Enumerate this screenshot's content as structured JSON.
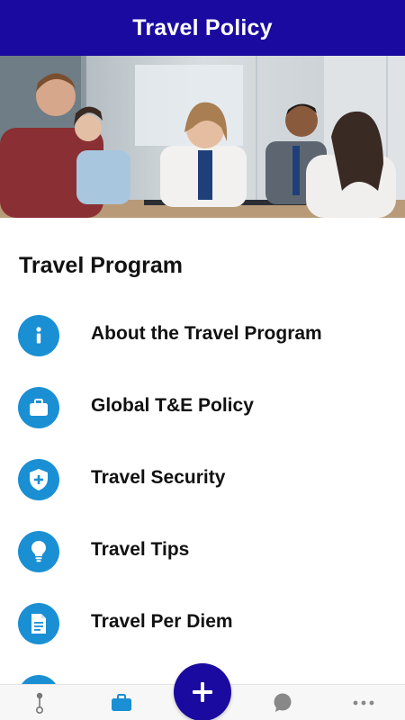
{
  "header": {
    "title": "Travel Policy"
  },
  "section": {
    "title": "Travel Program"
  },
  "menu": {
    "items": [
      {
        "label": "About the Travel Program",
        "icon": "info-icon"
      },
      {
        "label": "Global T&E Policy",
        "icon": "briefcase-icon"
      },
      {
        "label": "Travel Security",
        "icon": "shield-plus-icon"
      },
      {
        "label": "Travel Tips",
        "icon": "lightbulb-icon"
      },
      {
        "label": "Travel Per Diem",
        "icon": "document-icon"
      }
    ]
  },
  "bottom_nav": {
    "items": [
      {
        "icon": "route-icon"
      },
      {
        "icon": "briefcase-icon",
        "active": true
      },
      {
        "icon": "chat-bubble-icon"
      },
      {
        "icon": "more-dots-icon"
      }
    ],
    "fab_icon": "plus-icon"
  },
  "colors": {
    "header": "#1a0aa0",
    "accent": "#1a8fd3",
    "fab": "#1a0aa0"
  }
}
